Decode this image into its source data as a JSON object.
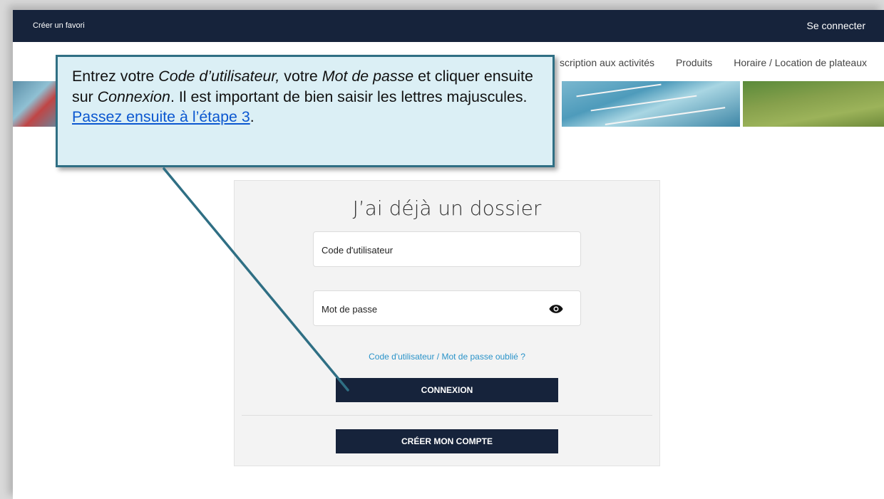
{
  "topbar": {
    "favorite_label": "Créer un favori",
    "login_label": "Se connecter",
    "background_color": "#16233b"
  },
  "nav": {
    "items": [
      "scription aux activités",
      "Produits",
      "Horaire / Location de plateaux"
    ]
  },
  "login_card": {
    "title": "J’ai déjà un dossier",
    "username_placeholder": "Code d'utilisateur",
    "password_placeholder": "Mot de passe",
    "show_password_icon": "eye-icon",
    "forgot_link": "Code d'utilisateur / Mot de passe oublié ?",
    "login_button": "CONNEXION",
    "create_account_button": "CRÉER MON COMPTE"
  },
  "callout": {
    "text_1": "Entrez votre ",
    "text_2": "Code d’utilisateur,",
    "text_3": " votre ",
    "text_4": "Mot de passe",
    "text_5": " et cliquer ensuite sur ",
    "text_6": "Connexion",
    "text_7": ". Il est important de bien saisir les lettres majuscules. ",
    "link": "Passez ensuite à l’étape 3",
    "text_8": ".",
    "background_color": "#dbeff5",
    "border_color": "#2f6f84"
  },
  "colors": {
    "accent_link": "#2a93c9",
    "button": "#16233b"
  }
}
